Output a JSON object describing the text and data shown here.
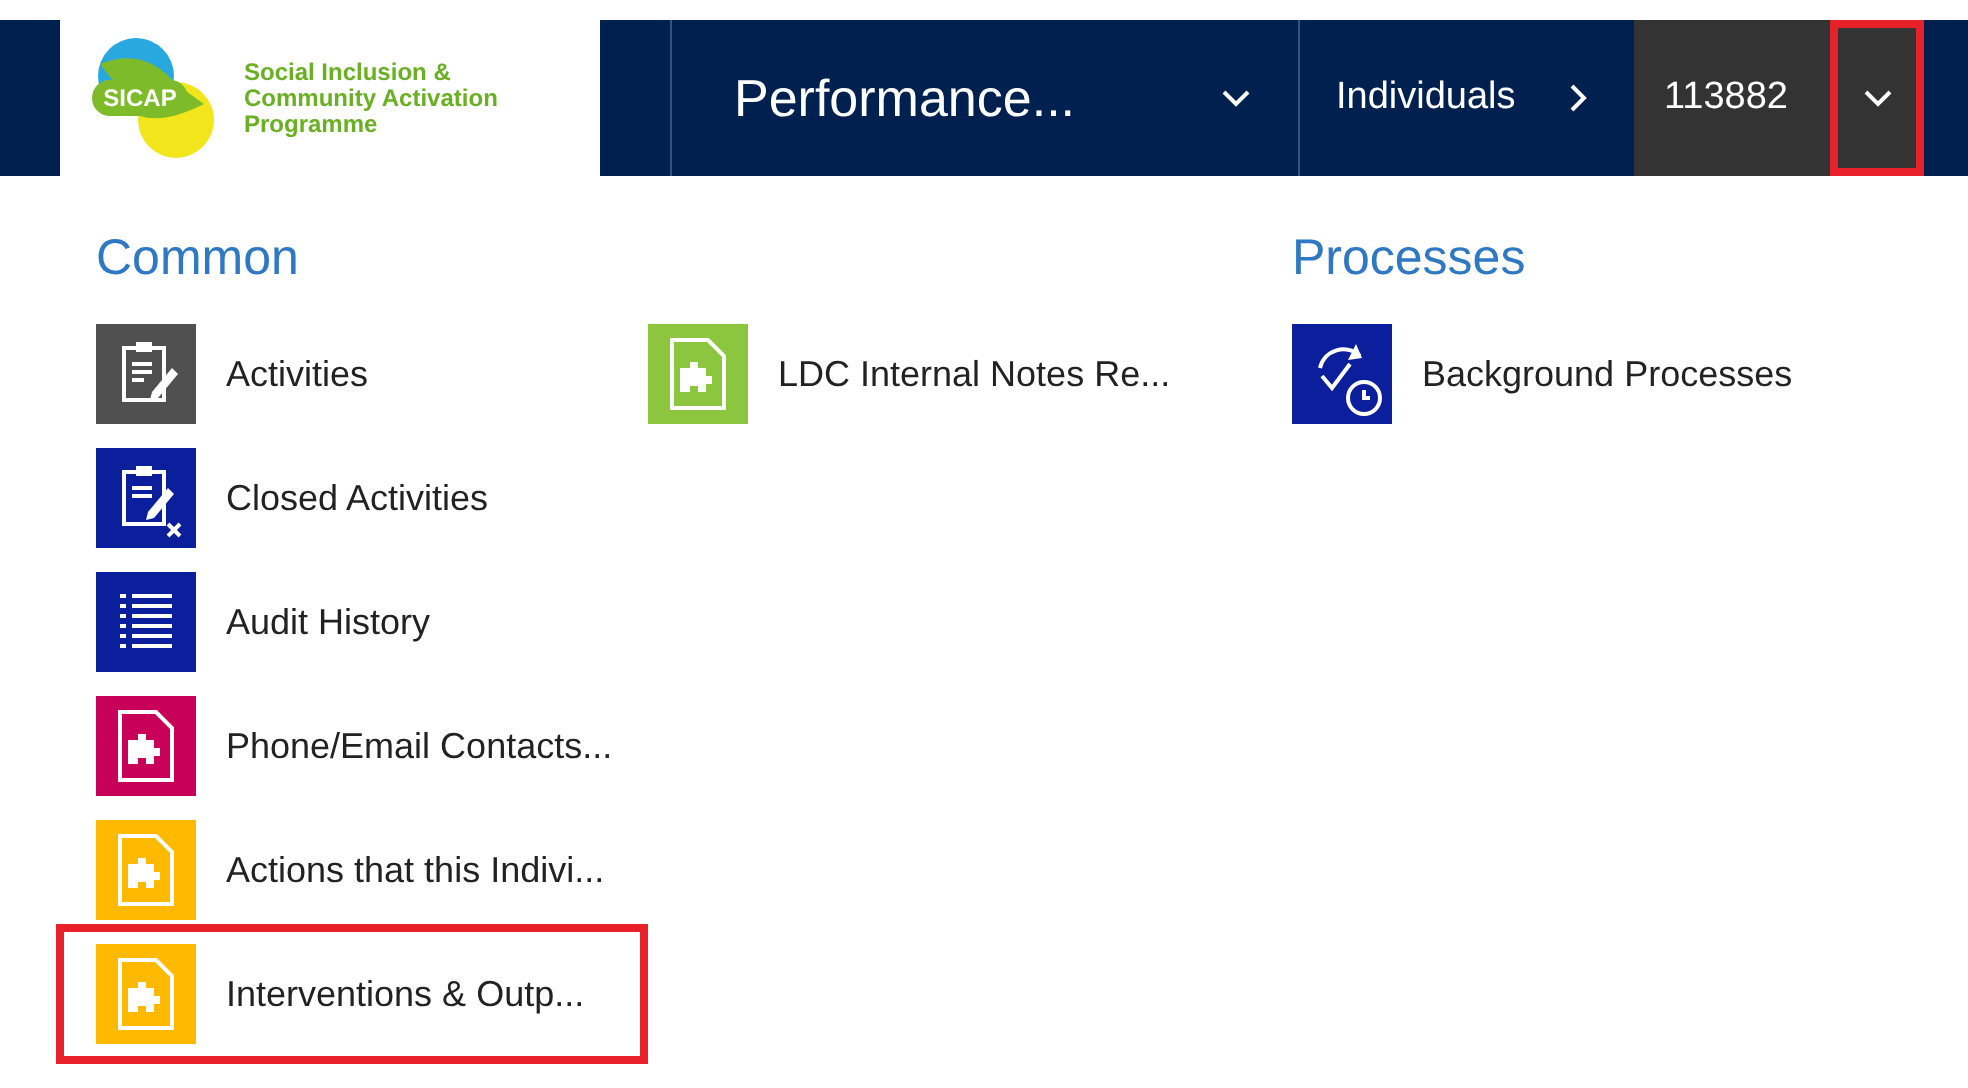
{
  "logo": {
    "badge": "SICAP",
    "lines": [
      "Social Inclusion &",
      "Community Activation",
      "Programme"
    ]
  },
  "nav": {
    "area": "Performance...",
    "breadcrumb": "Individuals",
    "record": "113882",
    "record_menu_highlighted": true
  },
  "columns": [
    {
      "heading": "Common",
      "items": [
        {
          "label": "Activities",
          "kind": "clipboard",
          "color": "#505050",
          "highlighted": false
        },
        {
          "label": "Closed Activities",
          "kind": "clipboard-x",
          "color": "#0b1e9c",
          "highlighted": false
        },
        {
          "label": "Audit History",
          "kind": "list",
          "color": "#0b1e9c",
          "highlighted": false
        },
        {
          "label": "Phone/Email Contacts...",
          "kind": "puzzle",
          "color": "#c8005a",
          "highlighted": false
        },
        {
          "label": "Actions that this Indivi...",
          "kind": "puzzle",
          "color": "#ffba00",
          "highlighted": false
        },
        {
          "label": "Interventions & Outp...",
          "kind": "puzzle",
          "color": "#ffba00",
          "highlighted": true
        }
      ]
    },
    {
      "items": [
        {
          "label": "LDC Internal Notes Re...",
          "kind": "puzzle",
          "color": "#8cc63f",
          "highlighted": false
        }
      ]
    },
    {
      "heading": "Processes",
      "items": [
        {
          "label": "Background Processes",
          "kind": "process",
          "color": "#0b1e9c",
          "highlighted": false
        }
      ]
    }
  ]
}
